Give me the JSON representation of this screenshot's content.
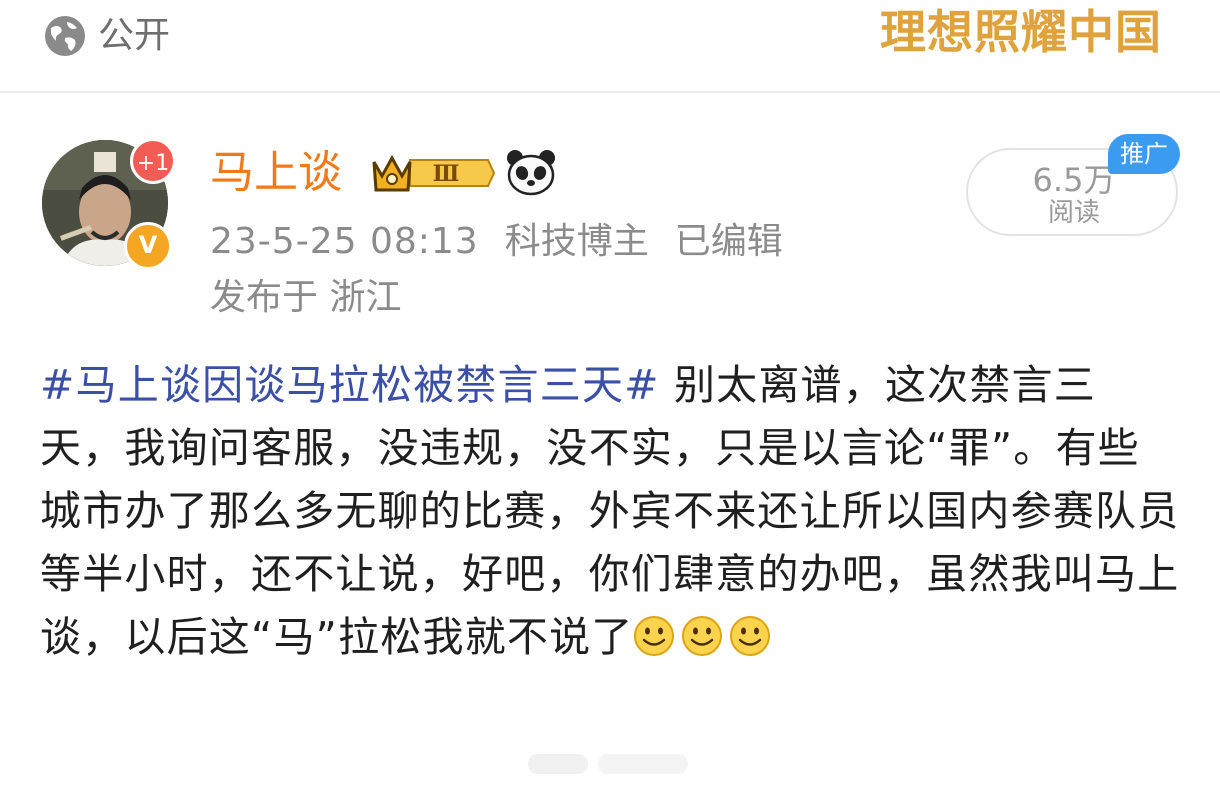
{
  "topbar": {
    "visibility_label": "公开",
    "banner_text": "理想照耀中国"
  },
  "author": {
    "name": "马上谈",
    "follow_badge": "+1",
    "verify_badge": "V",
    "level_badge": "Ⅲ",
    "timestamp": "23-5-25 08:13",
    "role": "科技博主",
    "edited": "已编辑",
    "location": "发布于 浙江"
  },
  "stats": {
    "read_count": "6.5万",
    "read_label": "阅读",
    "promo_tag": "推广"
  },
  "post": {
    "hashtag": "#马上谈因谈马拉松被禁言三天#",
    "text": " 别太离谱，这次禁言三天，我询问客服，没违规，没不实，只是以言论“罪”。有些城市办了那么多无聊的比赛，外宾不来还让所以国内参赛队员等半小时，还不让说，好吧，你们肆意的办吧，虽然我叫马上谈，以后这“马”拉松我就不说了",
    "emojis": [
      "smile-emoji",
      "smile-emoji",
      "smile-emoji"
    ]
  },
  "colors": {
    "author_name": "#f07a1a",
    "hashtag": "#3b4fa6",
    "meta_gray": "#8b8b8b",
    "promo_blue": "#3b9bf0",
    "banner_gold": "#e0a23a"
  }
}
